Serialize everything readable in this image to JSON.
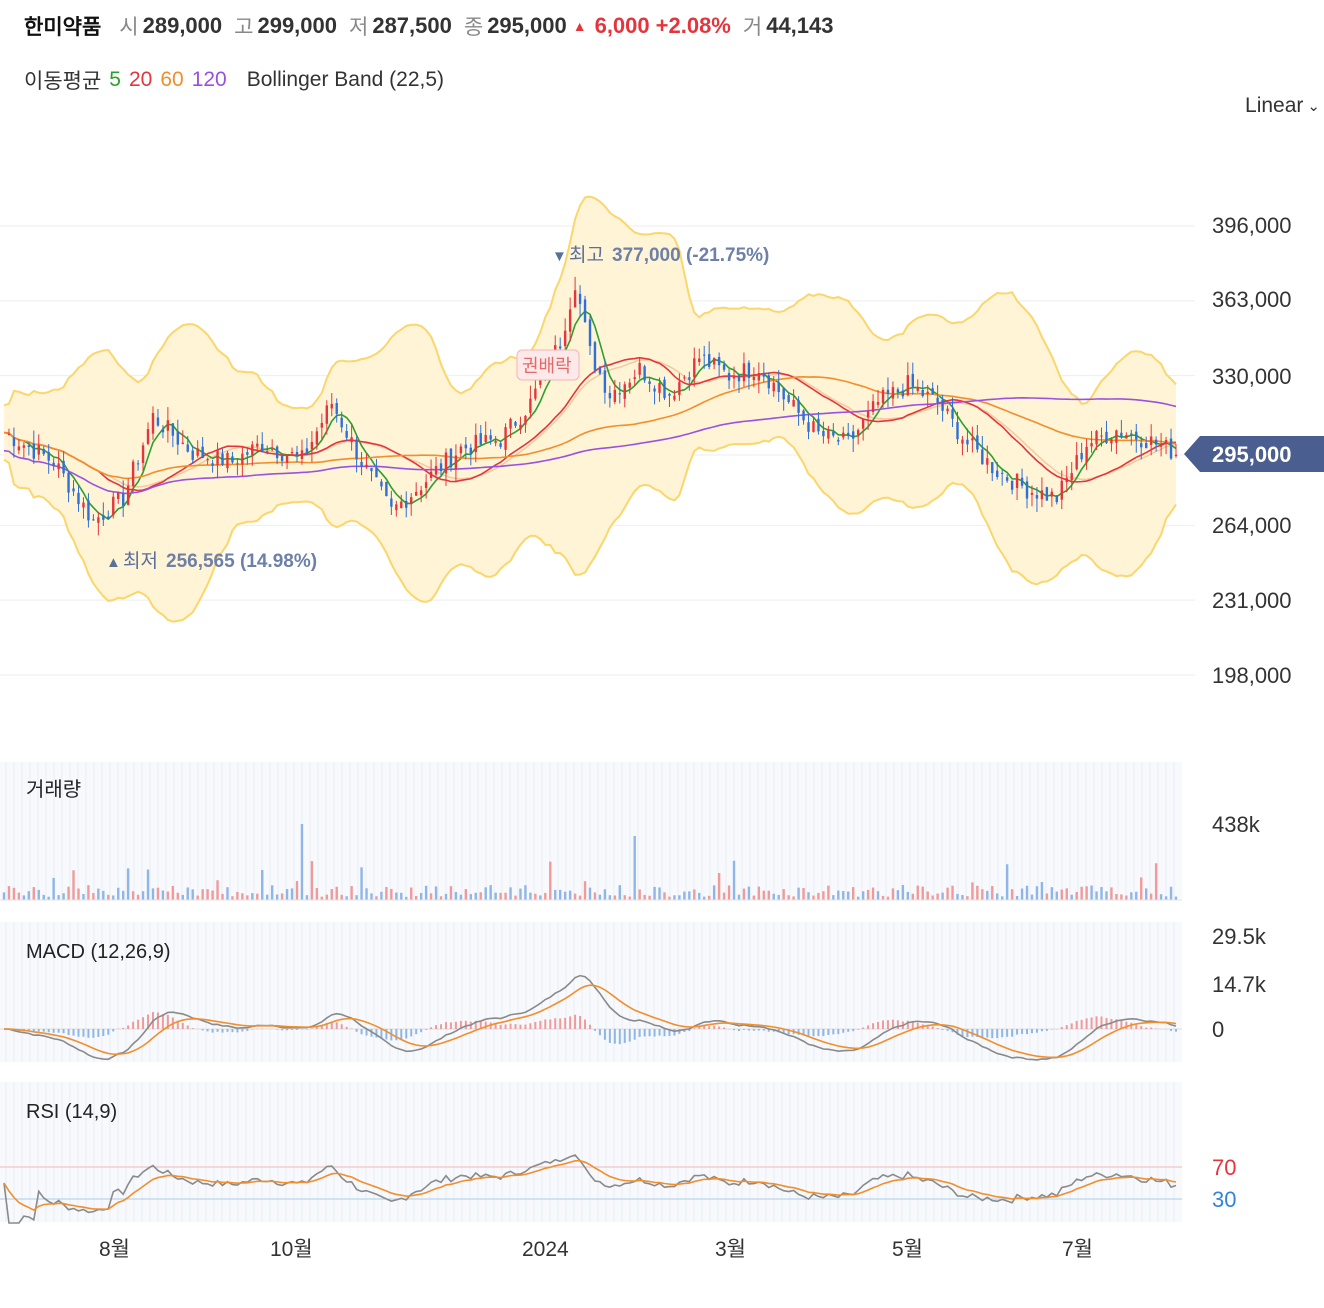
{
  "header": {
    "name": "한미약품",
    "open_label": "시",
    "open": "289,000",
    "high_label": "고",
    "high": "299,000",
    "low_label": "저",
    "low": "287,500",
    "close_label": "종",
    "close": "295,000",
    "change": "6,000",
    "change_pct": "+2.08%",
    "volume_label": "거",
    "volume": "44,143",
    "up_icon": "triangle-up-icon",
    "up_color": "#e5353c"
  },
  "indicators": {
    "ma_label": "이동평균",
    "ma_periods": [
      "5",
      "20",
      "60",
      "120"
    ],
    "ma_colors": [
      "#2ca02c",
      "#e5353c",
      "#f28e2b",
      "#9b51e0"
    ],
    "bollinger_label": "Bollinger Band (22,5)"
  },
  "scale_mode": {
    "label": "Linear",
    "icon": "chevron-down-icon"
  },
  "chart_data": [
    {
      "type": "candlestick",
      "panel": "price",
      "y_ticks": [
        "396,000",
        "363,000",
        "330,000",
        "264,000",
        "231,000",
        "198,000"
      ],
      "y_tick_values": [
        396000,
        363000,
        330000,
        264000,
        231000,
        198000
      ],
      "current_price_label": "295,000",
      "current_price": 295000,
      "high_marker": {
        "icon": "triangle-down-icon",
        "label": "최고",
        "value_text": "377,000 (-21.75%)",
        "value": 377000
      },
      "low_marker": {
        "icon": "triangle-up-icon",
        "label": "최저",
        "value_text": "256,565 (14.98%)",
        "value": 256565
      },
      "event_badge": "권배락",
      "x_ticks": [
        "8월",
        "10월",
        "2024",
        "3월",
        "5월",
        "7월"
      ],
      "up_color": "#e5353c",
      "down_color": "#2f6fd6",
      "band_color": "#fff4d6",
      "band_line_color": "#fbd66b"
    },
    {
      "type": "bar",
      "panel": "volume",
      "title": "거래량",
      "y_ticks": [
        "438k"
      ]
    },
    {
      "type": "line",
      "panel": "macd",
      "title": "MACD (12,26,9)",
      "y_ticks": [
        "29.5k",
        "14.7k",
        "0"
      ],
      "series": [
        {
          "name": "MACD",
          "color": "#8a8a8a"
        },
        {
          "name": "Signal",
          "color": "#f28e2b"
        }
      ]
    },
    {
      "type": "line",
      "panel": "rsi",
      "title": "RSI (14,9)",
      "y_ticks": [
        "70",
        "30"
      ],
      "y_tick_colors": [
        "#e5353c",
        "#2f86d6"
      ],
      "series": [
        {
          "name": "RSI",
          "color": "#8a8a8a"
        },
        {
          "name": "Signal",
          "color": "#f28e2b"
        }
      ]
    }
  ]
}
